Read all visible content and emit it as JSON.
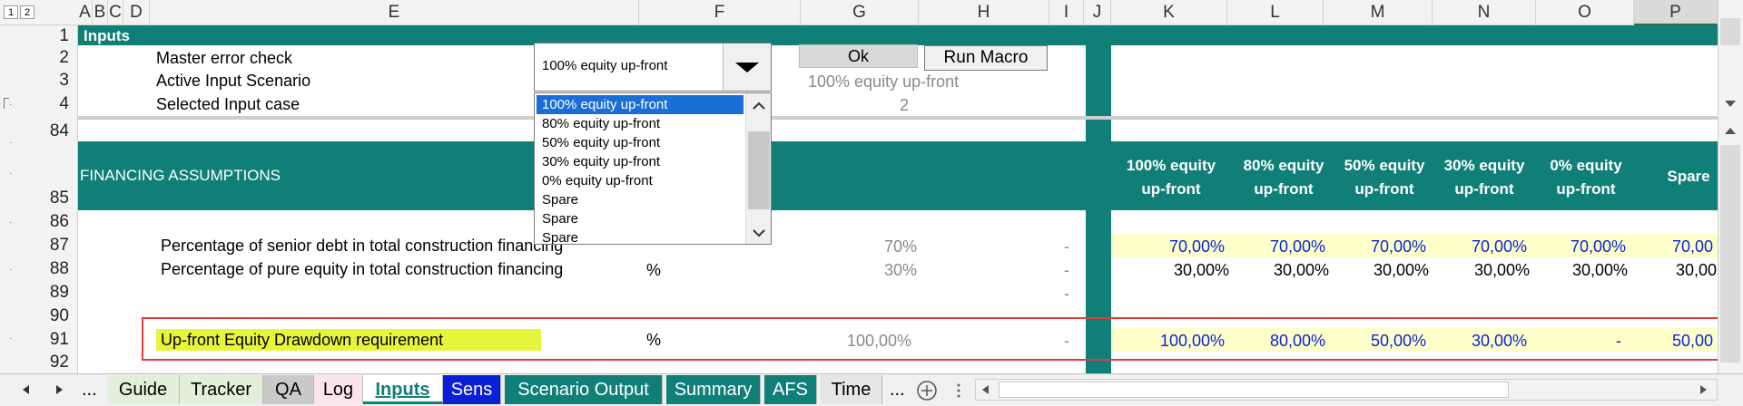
{
  "outline": {
    "level1": "1",
    "level2": "2"
  },
  "columns": [
    "A",
    "B",
    "C",
    "D",
    "E",
    "F",
    "G",
    "H",
    "I",
    "J",
    "K",
    "L",
    "M",
    "N",
    "O",
    "P"
  ],
  "rows": {
    "r1": "1",
    "r2": "2",
    "r3": "3",
    "r4": "4",
    "r84": "84",
    "r85": "85",
    "r86": "86",
    "r87": "87",
    "r88": "88",
    "r89": "89",
    "r90": "90",
    "r91": "91",
    "r92": "92"
  },
  "inputs_band": "Inputs",
  "labels": {
    "master_error": "Master error check",
    "active_scenario": "Active Input Scenario",
    "selected_case": "Selected Input case",
    "financing": "FINANCING ASSUMPTIONS",
    "senior_debt": "Percentage of senior debt in total construction financing",
    "pure_equity": "Percentage of pure equity in total construction financing",
    "upfront": "Up-front Equity Drawdown requirement"
  },
  "combo": {
    "value": "100% equity up-front",
    "options": [
      "100% equity up-front",
      "80% equity up-front",
      "50% equity up-front",
      "30% equity up-front",
      "0% equity up-front",
      "Spare",
      "Spare",
      "Spare"
    ]
  },
  "buttons": {
    "ok": "Ok",
    "run_macro": "Run Macro"
  },
  "values": {
    "active_scenario": "100% equity up-front",
    "selected_case": "2",
    "unit": "%",
    "g87": "70%",
    "g88": "30%",
    "g91": "100,00%",
    "dash": "-"
  },
  "scenario_headers": [
    [
      "100% equity",
      "up-front"
    ],
    [
      "80% equity",
      "up-front"
    ],
    [
      "50% equity",
      "up-front"
    ],
    [
      "30% equity",
      "up-front"
    ],
    [
      "0% equity",
      "up-front"
    ],
    [
      "Spare",
      ""
    ]
  ],
  "row87": [
    "70,00%",
    "70,00%",
    "70,00%",
    "70,00%",
    "70,00%",
    "70,00"
  ],
  "row88": [
    "30,00%",
    "30,00%",
    "30,00%",
    "30,00%",
    "30,00%",
    "30,00"
  ],
  "row91": [
    "100,00%",
    "80,00%",
    "50,00%",
    "30,00%",
    "-",
    "50,00"
  ],
  "tabs": {
    "more_left": "...",
    "items": [
      "Guide",
      "Tracker",
      "QA",
      "Log",
      "Inputs",
      "Sens",
      "Scenario Output",
      "Summary",
      "AFS",
      "Time"
    ],
    "more_right": "..."
  },
  "colors": {
    "teal": "#0f7f78",
    "input_yellow": "#ffffcc",
    "highlight_yellow": "#e6f53a",
    "selection_blue": "#1a6fd6",
    "tab_blue": "#0a1fd6"
  }
}
